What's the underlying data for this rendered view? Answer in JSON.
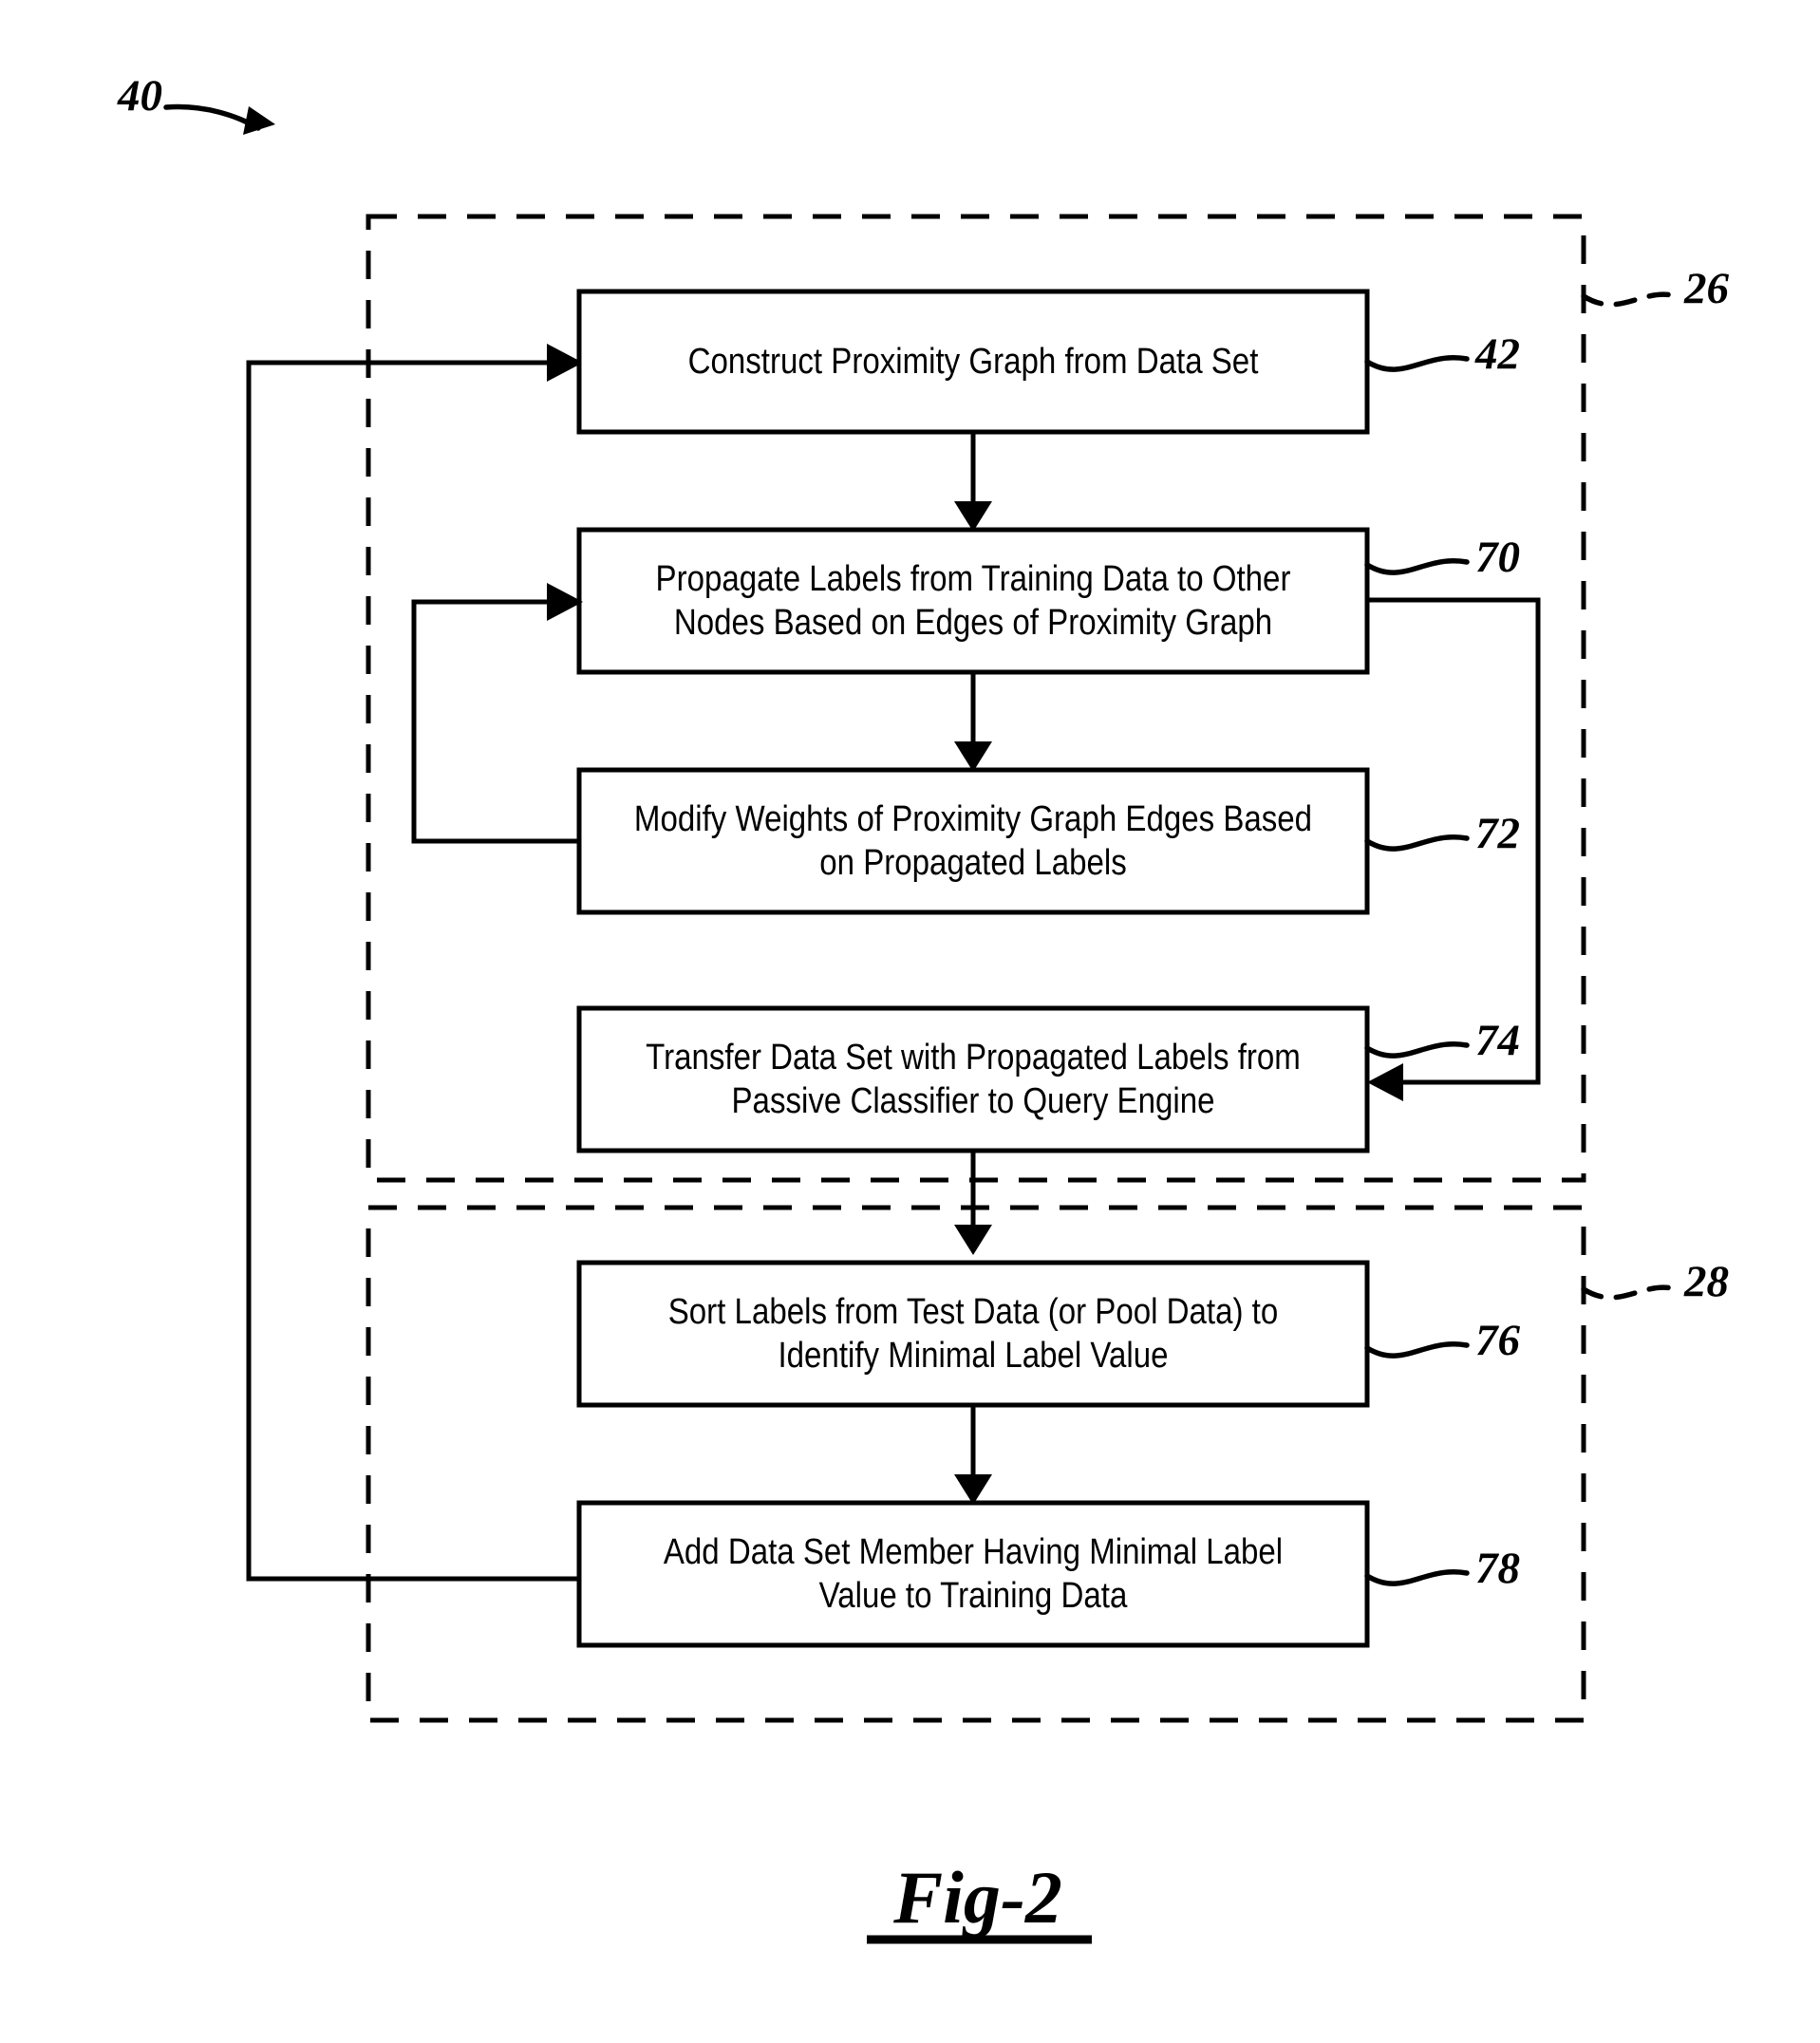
{
  "figure": {
    "caption": "Fig-2",
    "root_ref": "40"
  },
  "regions": [
    {
      "id": "region-passive-classifier",
      "ref": "26"
    },
    {
      "id": "region-query-engine",
      "ref": "28"
    }
  ],
  "boxes": [
    {
      "id": "box-42",
      "ref": "42",
      "text": "Construct Proximity Graph from Data Set",
      "lines": [
        "Construct Proximity Graph from Data Set"
      ]
    },
    {
      "id": "box-70",
      "ref": "70",
      "text": "Propagate Labels from Training Data to Other Nodes Based on Edges of Proximity Graph",
      "lines": [
        "Propagate Labels from Training Data to Other",
        "Nodes Based on Edges of Proximity Graph"
      ]
    },
    {
      "id": "box-72",
      "ref": "72",
      "text": "Modify Weights of Proximity Graph Edges Based on Propagated Labels",
      "lines": [
        "Modify Weights of Proximity Graph Edges Based",
        "on Propagated Labels"
      ]
    },
    {
      "id": "box-74",
      "ref": "74",
      "text": "Transfer Data Set with Propagated Labels from Passive Classifier to Query Engine",
      "lines": [
        "Transfer Data Set with Propagated Labels from",
        "Passive Classifier to Query Engine"
      ]
    },
    {
      "id": "box-76",
      "ref": "76",
      "text": "Sort Labels from Test Data (or Pool Data) to Identify Minimal Label Value",
      "lines": [
        "Sort Labels from Test Data (or Pool Data) to",
        "Identify Minimal Label Value"
      ]
    },
    {
      "id": "box-78",
      "ref": "78",
      "text": "Add Data Set Member Having Minimal Label Value to Training Data",
      "lines": [
        "Add Data Set Member Having Minimal Label",
        "Value to Training Data"
      ]
    }
  ],
  "colors": {
    "ink": "#000000",
    "paper": "#ffffff"
  }
}
